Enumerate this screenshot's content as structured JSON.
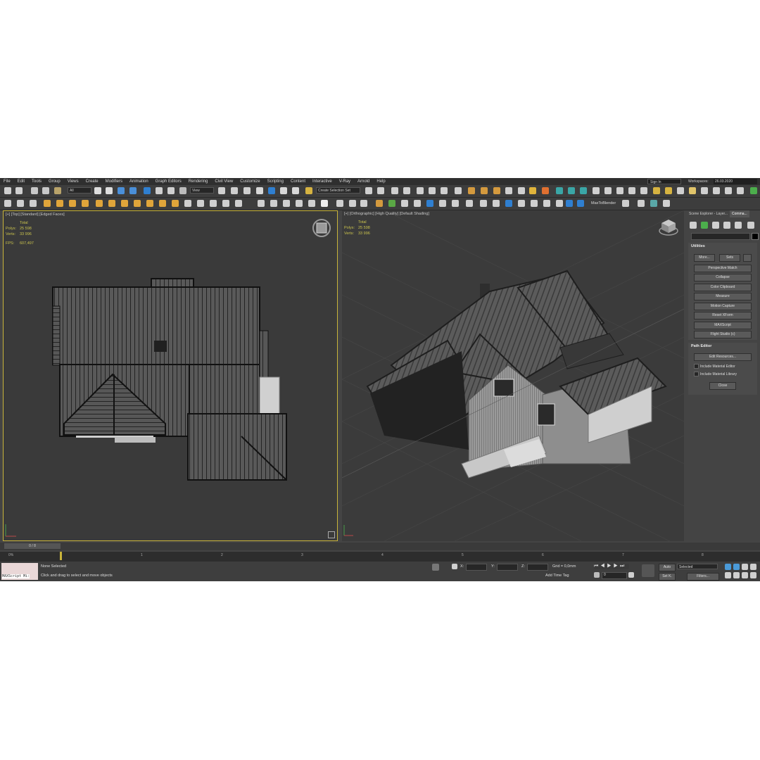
{
  "menu": [
    "File",
    "Edit",
    "Tools",
    "Group",
    "Views",
    "Create",
    "Modifiers",
    "Animation",
    "Graph Editors",
    "Rendering",
    "Civil View",
    "Customize",
    "Scripting",
    "Content",
    "Interactive",
    "V-Ray",
    "Arnold",
    "Help"
  ],
  "header": {
    "signin": "Sign In",
    "workspaces_label": "Workspaces:",
    "workspace_value": "26.03.2020"
  },
  "toolbar": {
    "filter": "All",
    "ref_coord": "View",
    "selection_set": "Create Selection Set",
    "max_to_blender": "MaxToBlender"
  },
  "viewports": {
    "left": {
      "label": "[+] [Top] [Standard] [Edged Faces]",
      "stats_title": "Total",
      "polys_label": "Polys:",
      "polys": "25 598",
      "verts_label": "Verts:",
      "verts": "33 996",
      "fps_label": "FPS:",
      "fps": "607,497"
    },
    "right": {
      "label": "[+] [Orthographic] [High Quality] [Default Shading]",
      "stats_title": "Total",
      "polys_label": "Polys:",
      "polys": "25 598",
      "verts_label": "Verts:",
      "verts": "33 996"
    }
  },
  "command_panel": {
    "tabs": [
      "Scene Explorer - Layer...",
      "Comma..."
    ],
    "utilities": {
      "title": "Utilities",
      "more": "More...",
      "sets": "Sets",
      "items": [
        "Perspective Match",
        "Collapse",
        "Color Clipboard",
        "Measure",
        "Motion Capture",
        "Reset XForm",
        "MAXScript",
        "Flight Studio (c)"
      ]
    },
    "path_editor": {
      "title": "Path Editor",
      "edit_resources": "Edit Resources...",
      "include_material_editor": "Include Material Editor",
      "include_material_library": "Include Material Library",
      "close": "Close"
    }
  },
  "timeline": {
    "frame": "0 / 8",
    "percent": "0%",
    "ticks": [
      "1",
      "2",
      "3",
      "4",
      "5",
      "6",
      "7",
      "8"
    ]
  },
  "status": {
    "maxscript": "MAXScript Mi:",
    "selection": "None Selected",
    "prompt": "Click and drag to select and move objects",
    "x_label": "X:",
    "y_label": "Y:",
    "z_label": "Z:",
    "grid": "Grid = 0,0mm",
    "add_time_tag": "Add Time Tag",
    "auto": "Auto",
    "set_key": "Set K.",
    "selected": "Selected",
    "filters": "Filters...",
    "frame_value": "0"
  },
  "colors": {
    "active_border": "#c9b43a",
    "stat_text": "#c9c24d",
    "accent_blue": "#2f7fd0"
  }
}
